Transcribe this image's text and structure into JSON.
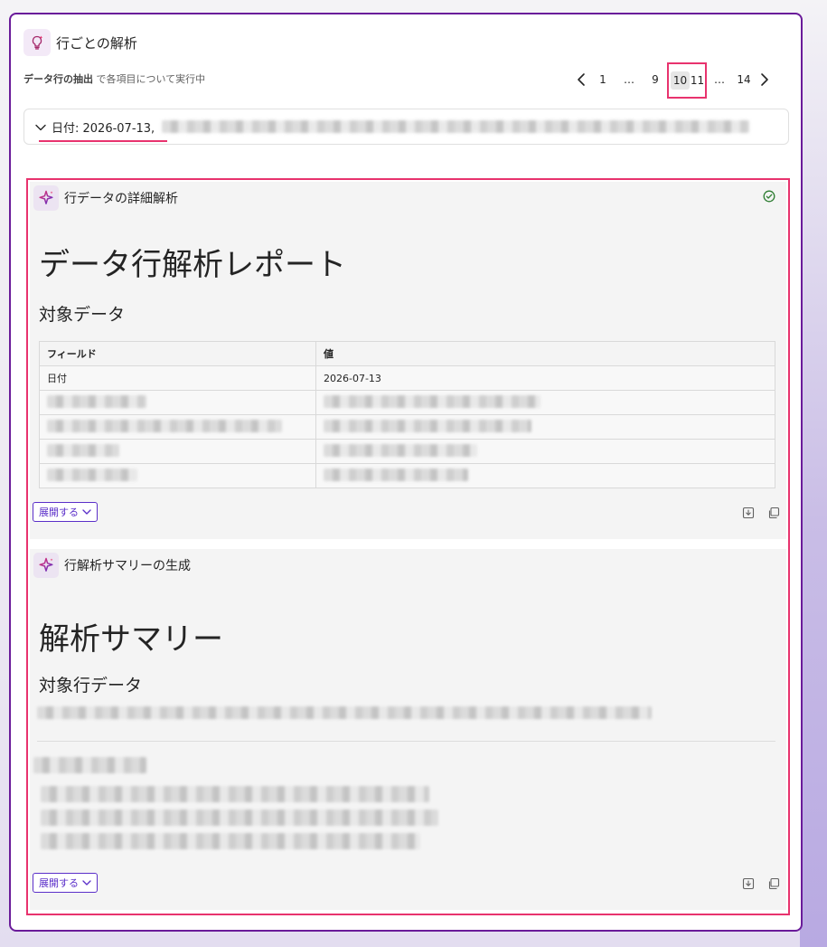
{
  "header": {
    "title": "行ごとの解析",
    "icon": "lightbulb-sparkle-icon"
  },
  "subline": {
    "bold": "データ行の抽出",
    "rest": " で各項目について実行中"
  },
  "pagination": {
    "prev_icon": "chevron-left-icon",
    "next_icon": "chevron-right-icon",
    "pages": [
      "1",
      "…",
      "9",
      "10",
      "11",
      "…",
      "14"
    ],
    "current": "10"
  },
  "filter": {
    "label": "日付: 2026-07-13,",
    "toggle_icon": "chevron-down-icon"
  },
  "section1": {
    "title": "行データの詳細解析",
    "status_icon": "check-circle-icon",
    "heading": "データ行解析レポート",
    "subheading": "対象データ",
    "table": {
      "headers": [
        "フィールド",
        "値"
      ],
      "first_row": [
        "日付",
        "2026-07-13"
      ]
    },
    "expand_label": "展開する"
  },
  "section2": {
    "title": "行解析サマリーの生成",
    "heading": "解析サマリー",
    "subheading": "対象行データ",
    "expand_label": "展開する"
  },
  "colors": {
    "accent": "#6a1b9a",
    "highlight": "#e8336e",
    "button": "#5b2fc9"
  }
}
